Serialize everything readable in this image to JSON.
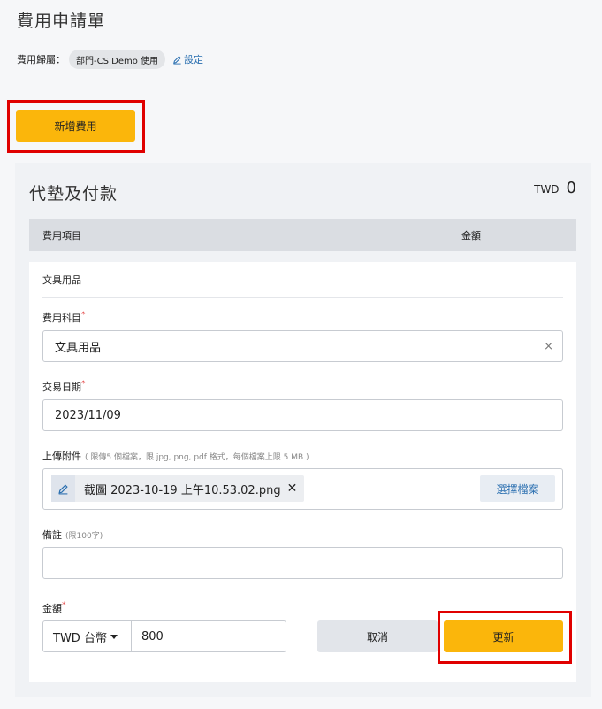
{
  "page": {
    "title": "費用申請單"
  },
  "belong": {
    "label": "費用歸屬：",
    "value": "部門-CS Demo 使用",
    "settings_link": "設定"
  },
  "add_button": "新增費用",
  "panel": {
    "title": "代墊及付款",
    "currency": "TWD",
    "total": "0",
    "table_headers": [
      "費用項目",
      "金額"
    ]
  },
  "item": {
    "name": "文具用品",
    "category": {
      "label": "費用科目",
      "value": "文具用品",
      "clear": "×"
    },
    "date": {
      "label": "交易日期",
      "value": "2023/11/09"
    },
    "attachment": {
      "label": "上傳附件",
      "hint": "( 限傳5 個檔案，限 jpg, png, pdf 格式，每個檔案上限 5 MB )",
      "file_name": "截圖 2023-10-19 上午10.53.02.png",
      "remove": "✕",
      "choose_button": "選擇檔案"
    },
    "note": {
      "label": "備註",
      "hint": "(限100字)",
      "value": ""
    },
    "amount": {
      "label": "金額",
      "currency": "TWD 台幣",
      "value": "800"
    },
    "required_mark": "*",
    "cancel_button": "取消",
    "update_button": "更新"
  },
  "colors": {
    "accent": "#fbb60b",
    "link": "#2a6fb0",
    "highlight": "#e00000"
  }
}
